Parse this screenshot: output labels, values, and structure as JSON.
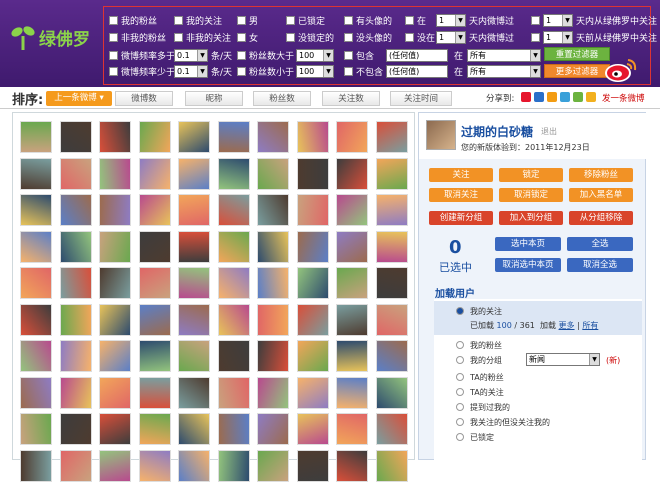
{
  "app": {
    "name": "绿佛罗"
  },
  "filters": {
    "row1": [
      "我的粉丝",
      "我的关注",
      "男",
      "已锁定",
      "有头像的"
    ],
    "row2": [
      "非我的粉丝",
      "非我的关注",
      "女",
      "没锁定的",
      "没头像的"
    ],
    "row3": [
      "微博频率多于",
      "条/天",
      "粉丝数大于",
      "包含",
      "在"
    ],
    "row4": [
      "微博频率少于",
      "条/天",
      "粉丝数小于",
      "不包含",
      "在"
    ],
    "in_label": "在",
    "notin_label": "没在",
    "day_select": "1",
    "row1_tail_a": "天内微博过",
    "row2_tail_a": "天内微博过",
    "row1_tail_b": "天内从绿佛罗中关注",
    "row2_tail_b": "天前从绿佛罗中关注",
    "freq_more": "0.1",
    "freq_less": "0.1",
    "fans_more": "100",
    "fans_less": "100",
    "contains_ph": "(任何值)",
    "notcontains_ph": "(任何值)",
    "scope_all": "所有",
    "btn_reset": "重置过滤器",
    "btn_more": "更多过滤器"
  },
  "nav": {
    "sort_label": "排序:",
    "sort_current": "上一条微博",
    "tabs": [
      "微博数",
      "昵称",
      "粉丝数",
      "关注数",
      "关注时间"
    ],
    "share": "分享到:",
    "send": "发一条微博"
  },
  "profile": {
    "name": "过期的白砂糖",
    "logout": "退出",
    "sign": "您的新版体验到：2011年12月23日"
  },
  "actions": {
    "row1": [
      "关注",
      "锁定",
      "移除粉丝"
    ],
    "row2": [
      "取消关注",
      "取消锁定",
      "加入黑名单"
    ],
    "row3": [
      "创建新分组",
      "加入到分组",
      "从分组移除"
    ]
  },
  "selection": {
    "count": "0",
    "label": "已选中",
    "btn_select_page": "选中本页",
    "btn_select_all": "全选",
    "btn_unselect_page": "取消选中本页",
    "btn_unselect_all": "取消全选"
  },
  "load": {
    "title": "加载用户",
    "opt_follow": "我的关注",
    "loaded_prefix": "已加载",
    "loaded_num": "100",
    "loaded_sep": " / ",
    "loaded_total": "361",
    "load_word": "加载",
    "more": "更多",
    "sep": "|",
    "all": "所有",
    "opt_fans": "我的粉丝",
    "opt_group": "我的分组",
    "group_select": "新闻",
    "new_tag": "(新)",
    "opt_ta_fans": "TA的粉丝",
    "opt_ta_follow": "TA的关注",
    "opt_mentioned": "提到过我的",
    "opt_i_follow_not_back": "我关注的但没关注我的",
    "opt_locked": "已锁定"
  }
}
